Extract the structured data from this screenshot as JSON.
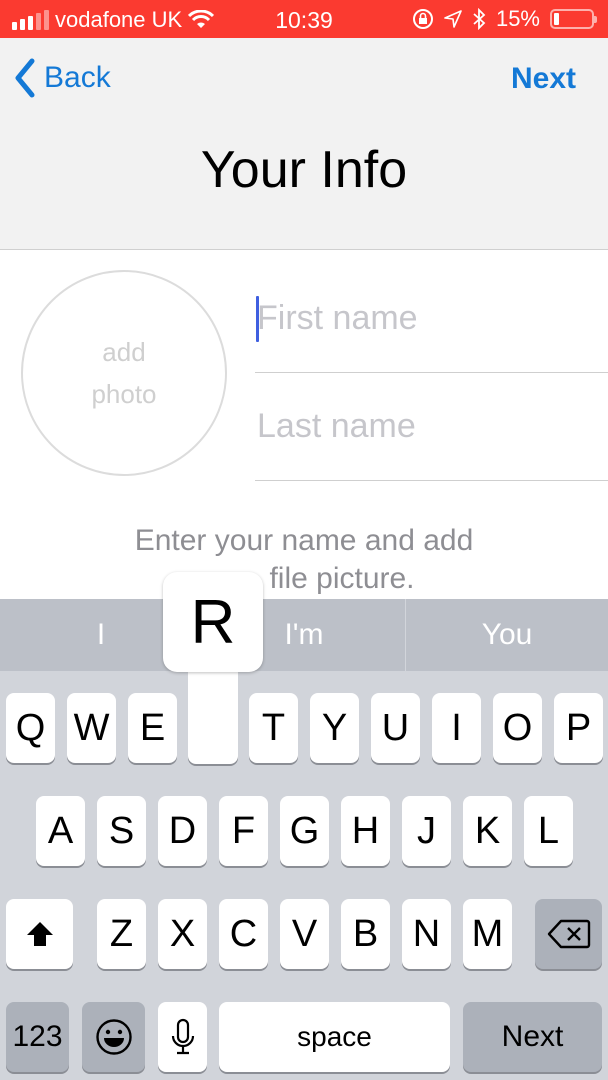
{
  "status_bar": {
    "carrier": "vodafone UK",
    "time": "10:39",
    "battery_percent": "15%",
    "battery_level": 0.15,
    "icons": [
      "signal-icon",
      "wifi-icon",
      "orientation-lock-icon",
      "location-icon",
      "bluetooth-icon",
      "battery-icon"
    ],
    "background": "#fb3a30"
  },
  "nav": {
    "back_label": "Back",
    "next_label": "Next",
    "title": "Your Info",
    "accent": "#1479d6"
  },
  "form": {
    "photo_label_line1": "add",
    "photo_label_line2": "photo",
    "first_name": {
      "value": "",
      "placeholder": "First name"
    },
    "last_name": {
      "value": "",
      "placeholder": "Last name"
    },
    "hint_line1": "Enter your name and add",
    "hint_line2": "file picture."
  },
  "keyboard": {
    "suggestions": [
      "I",
      "I'm",
      "You"
    ],
    "row1": [
      "Q",
      "W",
      "E",
      "R",
      "T",
      "Y",
      "U",
      "I",
      "O",
      "P"
    ],
    "row2": [
      "A",
      "S",
      "D",
      "F",
      "G",
      "H",
      "J",
      "K",
      "L"
    ],
    "row3": [
      "Z",
      "X",
      "C",
      "V",
      "B",
      "N",
      "M"
    ],
    "pressed_key": "R",
    "numbers_label": "123",
    "space_label": "space",
    "return_label": "Next"
  }
}
